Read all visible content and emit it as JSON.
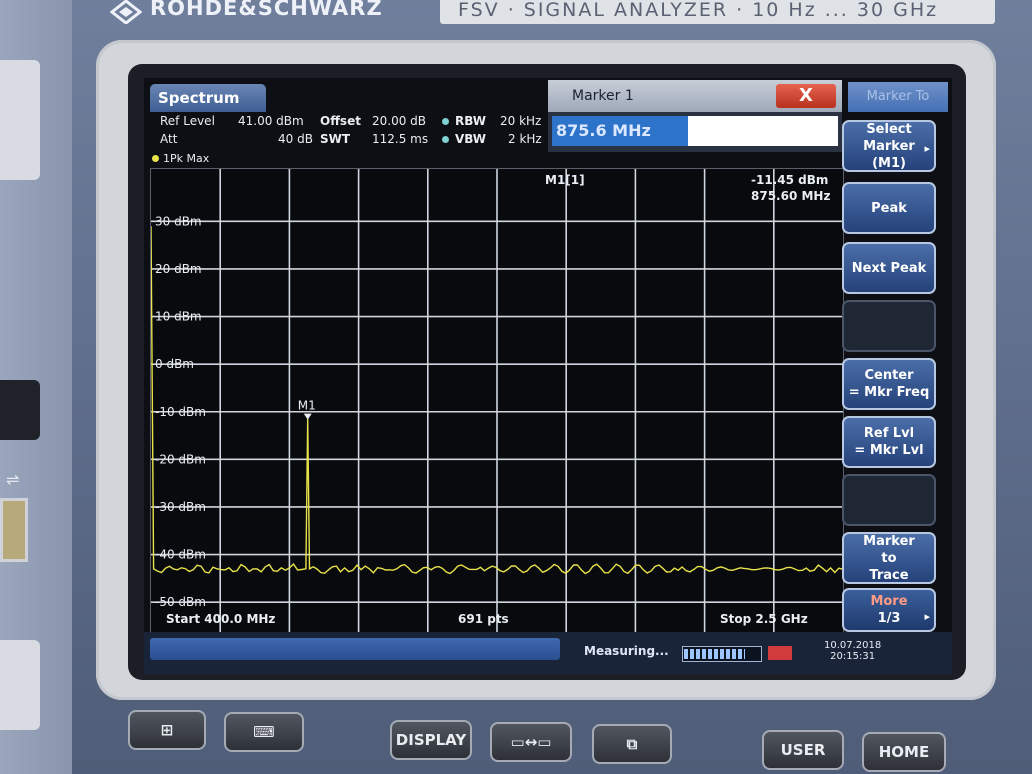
{
  "device": {
    "brand": "ROHDE&SCHWARZ",
    "model_plate": "FSV  ·  SIGNAL ANALYZER  ·  10 Hz ... 30 GHz"
  },
  "screen": {
    "tab_title": "Spectrum",
    "settings": {
      "ref_level_label": "Ref Level",
      "ref_level_value": "41.00 dBm",
      "offset_label": "Offset",
      "offset_value": "20.00 dB",
      "rbw_label": "RBW",
      "rbw_value": "20 kHz",
      "att_label": "Att",
      "att_value": "40 dB",
      "swt_label": "SWT",
      "swt_value": "112.5 ms",
      "vbw_label": "VBW",
      "vbw_value": "2 kHz"
    },
    "trace_label": "1Pk Max",
    "marker_readout": {
      "name": "M1[1]",
      "level": "-11.45 dBm",
      "freq": "875.60 MHz"
    },
    "marker_label": "M1",
    "footer": {
      "start": "Start 400.0 MHz",
      "points": "691 pts",
      "stop": "Stop 2.5 GHz"
    },
    "marker_dialog": {
      "title": "Marker 1",
      "close_symbol": "X",
      "input_value": "875.6 MHz"
    },
    "status": {
      "measuring": "Measuring...",
      "progress": 0.8,
      "date": "10.07.2018",
      "time": "20:15:31"
    }
  },
  "softkeys": {
    "header": "Marker To",
    "keys": [
      {
        "line1": "Select",
        "line2": "Marker",
        "line3": "(M1)"
      },
      {
        "line1": "Peak",
        "line2": "",
        "line3": ""
      },
      {
        "line1": "Next Peak",
        "line2": "",
        "line3": ""
      },
      {
        "line1": "",
        "line2": "",
        "line3": ""
      },
      {
        "line1": "Center",
        "line2": "= Mkr Freq",
        "line3": ""
      },
      {
        "line1": "Ref Lvl",
        "line2": "= Mkr Lvl",
        "line3": ""
      },
      {
        "line1": "",
        "line2": "",
        "line3": ""
      },
      {
        "line1": "Marker",
        "line2": "to",
        "line3": "Trace"
      },
      {
        "line1": "More",
        "line2": "1/3",
        "line3": ""
      }
    ]
  },
  "hardware_buttons": {
    "display": "DISPLAY",
    "user": "USER",
    "home": "HOME"
  },
  "chart_data": {
    "type": "line",
    "x_unit": "MHz",
    "y_unit": "dBm",
    "xlim": [
      400,
      2500
    ],
    "ylim": [
      -59,
      41
    ],
    "yticks": [
      {
        "value": 30,
        "label": "30 dBm"
      },
      {
        "value": 20,
        "label": "20 dBm"
      },
      {
        "value": 10,
        "label": "10 dBm"
      },
      {
        "value": 0,
        "label": "0 dBm"
      },
      {
        "value": -10,
        "label": "-10 dBm"
      },
      {
        "value": -20,
        "label": "-20 dBm"
      },
      {
        "value": -30,
        "label": "-30 dBm"
      },
      {
        "value": -40,
        "label": "-40 dBm"
      },
      {
        "value": -50,
        "label": "-50 dBm"
      }
    ],
    "grid": true,
    "noise_floor_dbm": -43,
    "series": [
      {
        "color": "#e9e24a",
        "points": [
          [
            400,
            29
          ],
          [
            408,
            -43
          ],
          [
            600,
            -43
          ],
          [
            820,
            -42.8
          ],
          [
            870,
            -43
          ],
          [
            875.6,
            -11.45
          ],
          [
            881,
            -43
          ],
          [
            950,
            -42.6
          ],
          [
            1000,
            -43.6
          ],
          [
            1100,
            -42.9
          ],
          [
            1250,
            -43.2
          ],
          [
            1400,
            -42.7
          ],
          [
            1600,
            -43.4
          ],
          [
            1800,
            -43.0
          ],
          [
            2000,
            -43.3
          ],
          [
            2200,
            -42.9
          ],
          [
            2400,
            -43.5
          ],
          [
            2500,
            -43.1
          ]
        ]
      }
    ],
    "marker": {
      "name": "M1",
      "x": 875.6,
      "y": -11.45
    }
  }
}
